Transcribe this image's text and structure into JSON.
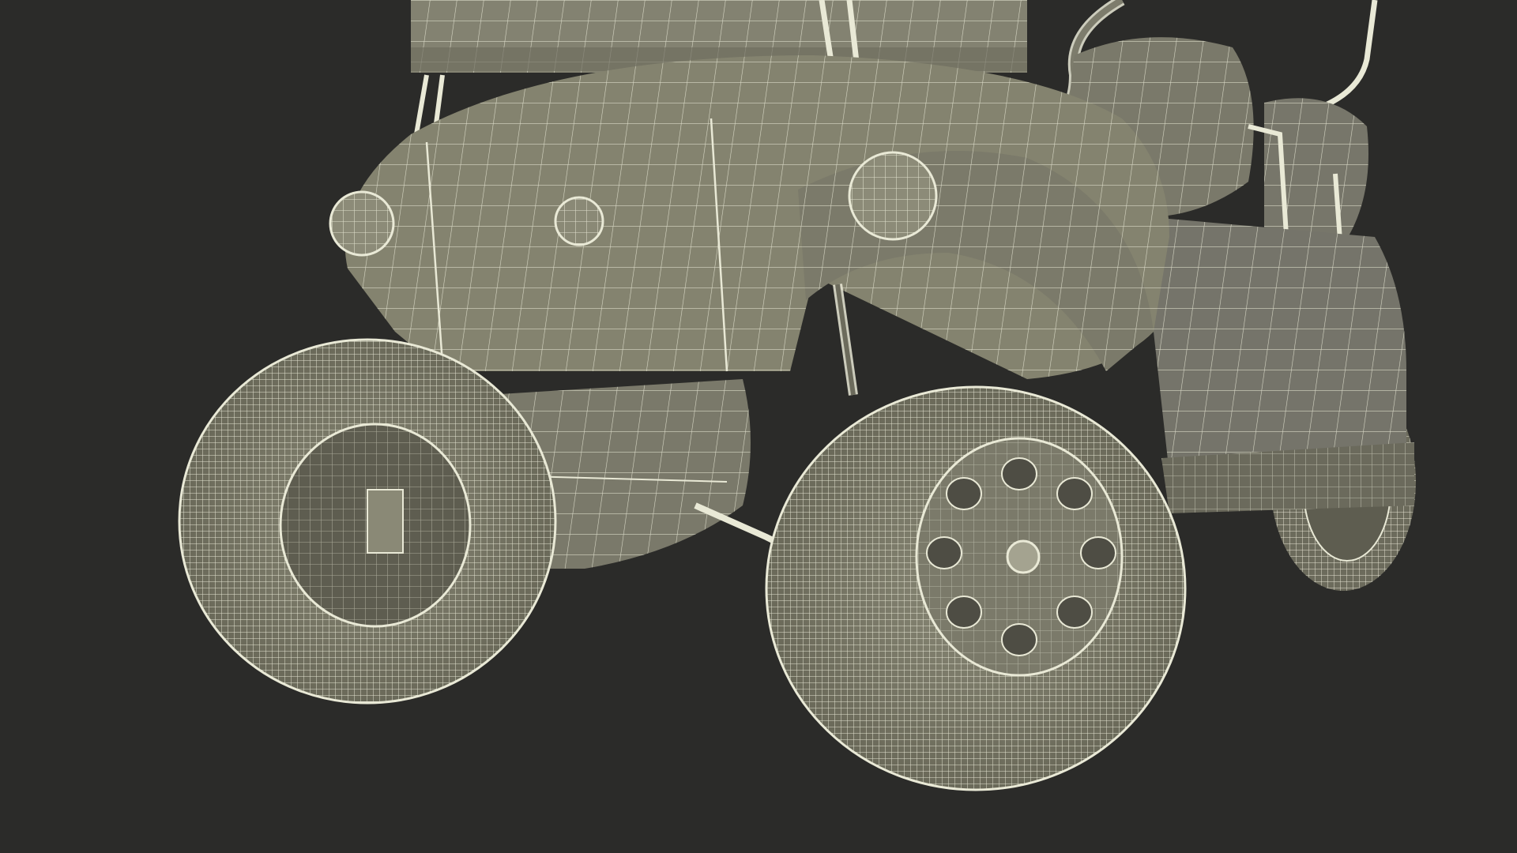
{
  "scene": {
    "subject": "golf-cart-wireframe-model",
    "render_style": "wireframe-on-clay",
    "colors": {
      "background": "#2b2b29",
      "surface_base": "#7d7c6c",
      "surface_shadow": "#5e5d50",
      "surface_highlight": "#9a9985",
      "wire": "#e9e9d6",
      "wire_dim": "#c9c9b6"
    }
  }
}
